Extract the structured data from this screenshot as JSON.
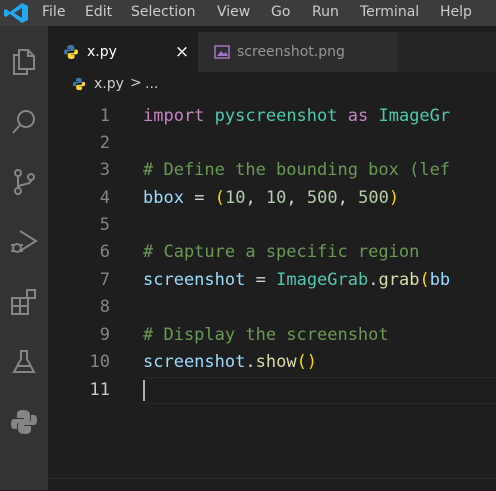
{
  "menu": [
    "File",
    "Edit",
    "Selection",
    "View",
    "Go",
    "Run",
    "Terminal",
    "Help"
  ],
  "tabs": [
    {
      "label": "x.py",
      "icon": "python-file-icon",
      "active": true
    },
    {
      "label": "screenshot.png",
      "icon": "image-file-icon",
      "active": false
    }
  ],
  "close_glyph": "×",
  "breadcrumb": {
    "file": "x.py",
    "separator": ">",
    "rest": "..."
  },
  "line_numbers": [
    "1",
    "2",
    "3",
    "4",
    "5",
    "6",
    "7",
    "8",
    "9",
    "10",
    "11"
  ],
  "code": {
    "l1": {
      "kw1": "import",
      "mod": "pyscreenshot",
      "kw2": "as",
      "alias": "ImageGr"
    },
    "l3": "# Define the bounding box (lef",
    "l4": {
      "var": "bbox",
      "eq": "=",
      "open": "(",
      "n1": "10",
      "n2": "10",
      "n3": "500",
      "n4": "500",
      "close": ")"
    },
    "l6": "# Capture a specific region",
    "l7": {
      "var": "screenshot",
      "eq": "=",
      "cls": "ImageGrab",
      "dot": ".",
      "fn": "grab",
      "open": "(",
      "arg": "bb"
    },
    "l9": "# Display the screenshot",
    "l10": {
      "var": "screenshot",
      "dot": ".",
      "fn": "show",
      "parens": "()"
    }
  },
  "colors": {
    "keyword": "#c586c0",
    "module": "#4ec9b0",
    "identifier": "#9cdcfe",
    "number": "#b5cea8",
    "comment": "#6a9955",
    "function": "#dcdcaa",
    "bracket": "#ffd700",
    "vscode_blue": "#23a9f2"
  }
}
